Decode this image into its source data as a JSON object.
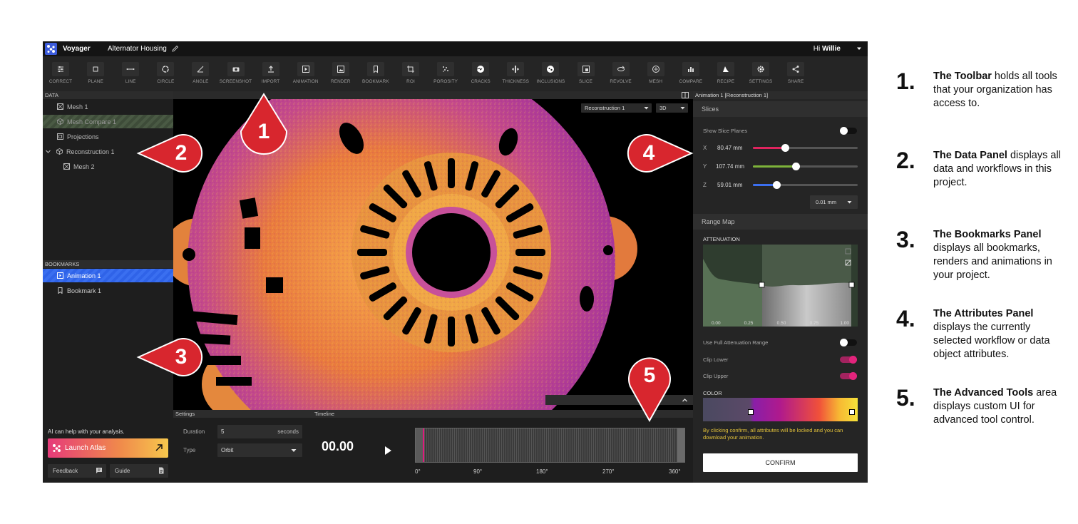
{
  "app": {
    "name": "Voyager",
    "project": "Alternator Housing",
    "greeting": "Hi",
    "user": "Willie"
  },
  "toolbar": [
    {
      "label": "CORRECT",
      "icon": "sliders-icon"
    },
    {
      "label": "PLANE",
      "icon": "square-icon"
    },
    {
      "label": "LINE",
      "icon": "line-icon"
    },
    {
      "label": "CIRCLE",
      "icon": "circle-icon"
    },
    {
      "label": "ANGLE",
      "icon": "angle-icon"
    },
    {
      "label": "SCREENSHOT",
      "icon": "camera-icon"
    },
    {
      "label": "IMPORT",
      "icon": "upload-icon"
    },
    {
      "label": "ANIMATION",
      "icon": "play-box-icon"
    },
    {
      "label": "RENDER",
      "icon": "image-icon"
    },
    {
      "label": "BOOKMARK",
      "icon": "bookmark-icon"
    },
    {
      "label": "ROI",
      "icon": "crop-icon"
    },
    {
      "label": "POROSITY",
      "icon": "dots-icon"
    },
    {
      "label": "CRACKS",
      "icon": "cracks-icon"
    },
    {
      "label": "THICKNESS",
      "icon": "thickness-icon"
    },
    {
      "label": "INCLUSIONS",
      "icon": "inclusions-icon"
    },
    {
      "label": "SLICE",
      "icon": "slice-icon"
    },
    {
      "label": "REVOLVE",
      "icon": "revolve-icon"
    },
    {
      "label": "MESH",
      "icon": "mesh-icon"
    },
    {
      "label": "COMPARE",
      "icon": "bar-chart-icon"
    },
    {
      "label": "RECIPE",
      "icon": "recipe-icon"
    },
    {
      "label": "SETTINGS",
      "icon": "gear-icon"
    },
    {
      "label": "SHARE",
      "icon": "share-icon"
    }
  ],
  "data_panel": {
    "header": "DATA",
    "items": [
      {
        "label": "Mesh 1",
        "icon": "mesh-icon"
      },
      {
        "label": "Mesh Compare 1",
        "icon": "cube-icon"
      },
      {
        "label": "Projections",
        "icon": "projection-icon"
      },
      {
        "label": "Reconstruction 1",
        "icon": "cube-icon"
      },
      {
        "label": "Mesh 2",
        "icon": "mesh-icon"
      }
    ]
  },
  "bookmarks_panel": {
    "header": "BOOKMARKS",
    "items": [
      {
        "label": "Animation 1",
        "icon": "play-box-icon"
      },
      {
        "label": "Bookmark 1",
        "icon": "bookmark-icon"
      }
    ]
  },
  "atlas": {
    "note": "AI can help with your analysis.",
    "label": "Launch Atlas",
    "feedback": "Feedback",
    "guide": "Guide"
  },
  "viewport": {
    "source": "Reconstruction 1",
    "mode": "3D"
  },
  "bottom": {
    "settings_header": "Settings",
    "timeline_header": "Timeline",
    "duration_label": "Duration",
    "duration_value": "5",
    "duration_unit": "seconds",
    "type_label": "Type",
    "type_value": "Orbit",
    "timecode": "00.00",
    "ticks": [
      "0°",
      "90°",
      "180°",
      "270°",
      "360°"
    ]
  },
  "attributes": {
    "header": "Animation 1 [Reconstruction 1]",
    "slices_title": "Slices",
    "show_slice_planes": "Show Slice Planes",
    "axes": [
      {
        "axis": "X",
        "value": "80.47 mm",
        "level": 0.31,
        "color": "#e0245e"
      },
      {
        "axis": "Y",
        "value": "107.74 mm",
        "level": 0.41,
        "color": "#7db33a"
      },
      {
        "axis": "Z",
        "value": "59.01 mm",
        "level": 0.23,
        "color": "#3b6ff0"
      }
    ],
    "step": "0.01 mm",
    "range_map_title": "Range Map",
    "attenuation_label": "ATTENUATION",
    "atten_ticks": [
      "0.00",
      "0.25",
      "0.50",
      "0.75",
      "1.00"
    ],
    "use_full": "Use Full Attenuation Range",
    "clip_lower": "Clip Lower",
    "clip_upper": "Clip Upper",
    "color_label": "COLOR",
    "note": "By clicking confirm, all attributes will be locked and you can download your animation.",
    "confirm": "CONFIRM"
  },
  "callouts": [
    "1",
    "2",
    "3",
    "4",
    "5"
  ],
  "legend": [
    {
      "num": "1.",
      "title": "The Toolbar",
      "rest": " holds all tools that your organization has access to."
    },
    {
      "num": "2.",
      "title": "The Data Panel",
      "rest": " displays all data and workflows in this project."
    },
    {
      "num": "3.",
      "title": "The Bookmarks Panel",
      "rest": " displays all bookmarks, renders and animations in your project."
    },
    {
      "num": "4.",
      "title": "The Attributes Panel",
      "rest": " displays the currently selected workflow or data object attributes."
    },
    {
      "num": "5.",
      "title": "The Advanced Tools",
      "rest": " area displays custom UI for advanced tool control."
    }
  ],
  "colors": {
    "accent": "#e0187d",
    "select_blue": "#2f63e8",
    "note_yellow": "#e3c23a",
    "callout_red": "#d8262e"
  }
}
